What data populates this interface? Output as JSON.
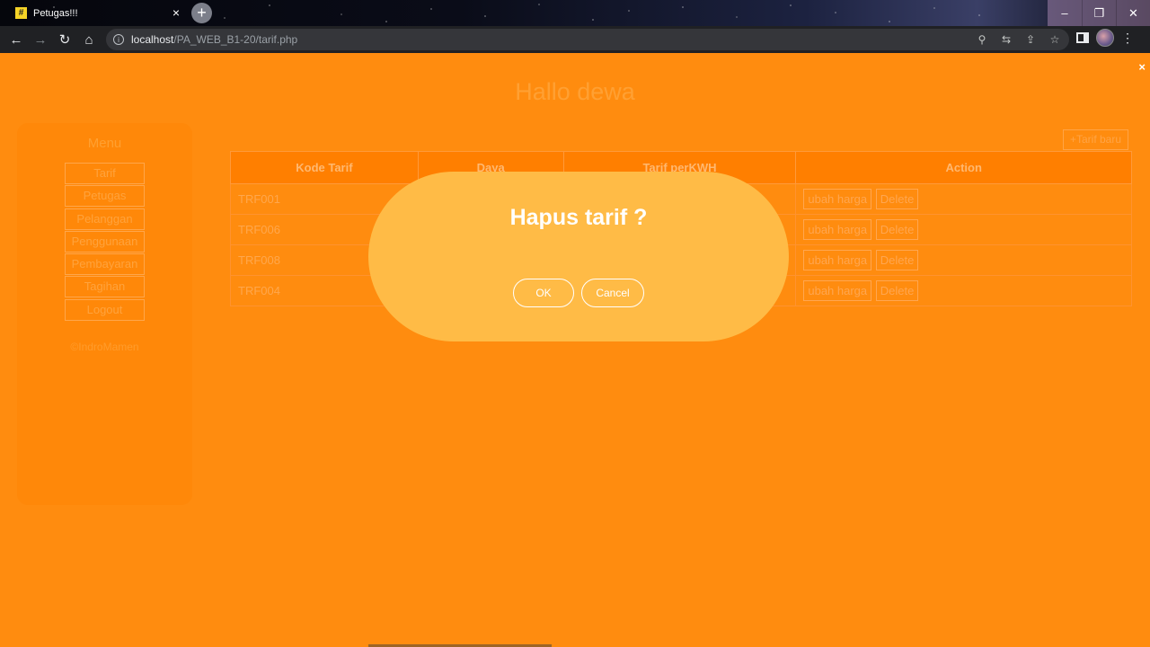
{
  "browser": {
    "tab_title": "Petugas!!!",
    "tab_close": "×",
    "new_tab": "+",
    "favicon_glyph": "#",
    "window_controls": [
      "–",
      "❐",
      "✕"
    ],
    "url_host": "localhost",
    "url_path": "/PA_WEB_B1-20/tarif.php",
    "info_glyph": "i",
    "icons": {
      "back": "←",
      "forward": "→",
      "reload": "↻",
      "home": "⌂",
      "zoom": "⚲",
      "translate": "⇆",
      "share": "⇪",
      "bookmark": "☆",
      "menu": "⋮"
    }
  },
  "page": {
    "close_glyph": "×",
    "greeting": "Hallo dewa",
    "sidebar": {
      "title": "Menu",
      "items": [
        "Tarif",
        "Petugas",
        "Pelanggan",
        "Penggunaan",
        "Pembayaran",
        "Tagihan",
        "Logout"
      ],
      "copyright": "©IndroMamen"
    },
    "add_button": "+Tarif baru",
    "table": {
      "headers": [
        "Kode Tarif",
        "Daya",
        "Tarif perKWH",
        "Action"
      ],
      "rows": [
        {
          "kode": "TRF001"
        },
        {
          "kode": "TRF006"
        },
        {
          "kode": "TRF008"
        },
        {
          "kode": "TRF004"
        }
      ],
      "edit_label": "ubah harga",
      "delete_label": "Delete"
    }
  },
  "modal": {
    "title": "Hapus tarif ?",
    "ok_label": "OK",
    "cancel_label": "Cancel"
  },
  "colors": {
    "page_background": "#ff8c0f",
    "modal_background": "#ffbb46",
    "table_header": "#ff7f00"
  }
}
